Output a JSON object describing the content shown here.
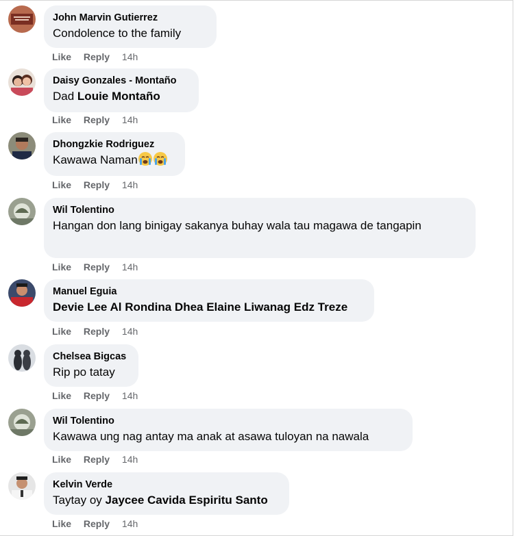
{
  "comments": [
    {
      "author": "John Marvin Gutierrez",
      "text_parts": [
        {
          "t": "Condolence to the family",
          "bold": false
        }
      ],
      "like": "Like",
      "reply": "Reply",
      "time": "14h"
    },
    {
      "author": "Daisy Gonzales - Montaño",
      "text_parts": [
        {
          "t": "Dad ",
          "bold": false
        },
        {
          "t": "Louie Montaño",
          "bold": true
        }
      ],
      "like": "Like",
      "reply": "Reply",
      "time": "14h"
    },
    {
      "author": "Dhongzkie Rodriguez",
      "text_parts": [
        {
          "t": "Kawawa Naman",
          "bold": false
        }
      ],
      "emoji": [
        "crying-face-icon",
        "crying-face-icon"
      ],
      "like": "Like",
      "reply": "Reply",
      "time": "14h"
    },
    {
      "author": "Wil Tolentino",
      "text_parts": [
        {
          "t": "Hangan don lang binigay sakanya buhay wala tau magawa de tangapin",
          "bold": false
        }
      ],
      "like": "Like",
      "reply": "Reply",
      "time": "14h"
    },
    {
      "author": "Manuel Eguia",
      "text_parts": [
        {
          "t": "Devie Lee Al Rondina Dhea Elaine Liwanag Edz Treze",
          "bold": true
        }
      ],
      "like": "Like",
      "reply": "Reply",
      "time": "14h"
    },
    {
      "author": "Chelsea Bigcas",
      "text_parts": [
        {
          "t": "Rip po tatay",
          "bold": false
        }
      ],
      "like": "Like",
      "reply": "Reply",
      "time": "14h"
    },
    {
      "author": "Wil Tolentino",
      "text_parts": [
        {
          "t": "Kawawa ung nag antay ma anak at asawa tuloyan na nawala",
          "bold": false
        }
      ],
      "like": "Like",
      "reply": "Reply",
      "time": "14h"
    },
    {
      "author": "Kelvin Verde",
      "text_parts": [
        {
          "t": "Taytay oy ",
          "bold": false
        },
        {
          "t": "Jaycee Cavida Espiritu Santo",
          "bold": true
        }
      ],
      "like": "Like",
      "reply": "Reply",
      "time": "14h"
    }
  ],
  "colors": {
    "bubble": "#f0f2f5",
    "meta": "#65676b",
    "text": "#050505"
  }
}
